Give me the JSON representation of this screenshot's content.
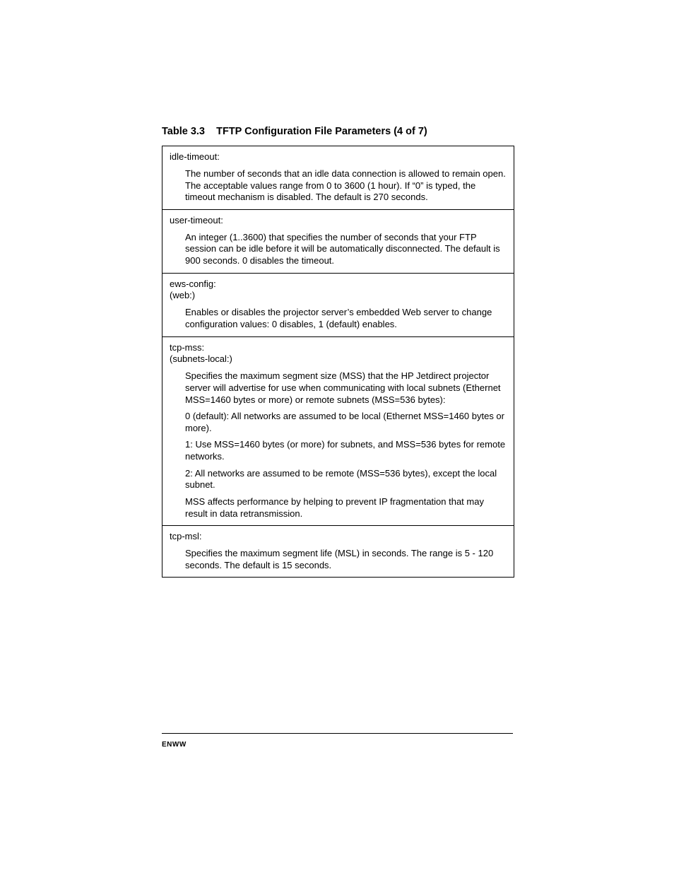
{
  "table": {
    "caption_prefix": "Table 3.3",
    "caption_title": "TFTP Configuration File Parameters (4 of 7)",
    "rows": [
      {
        "name": "idle-timeout:",
        "sub": "",
        "paras": [
          "The number of seconds that an idle data connection is allowed to remain open. The acceptable values range from 0 to 3600 (1 hour). If “0” is typed, the timeout mechanism is disabled. The default is 270 seconds."
        ]
      },
      {
        "name": "user-timeout:",
        "sub": "",
        "paras": [
          "An integer (1..3600) that specifies the number of seconds that your FTP session can be idle before it will be automatically disconnected. The default is 900 seconds. 0 disables the timeout."
        ]
      },
      {
        "name": "ews-config:",
        "sub": "(web:)",
        "paras": [
          "Enables or disables the projector server’s embedded Web server to change configuration values: 0 disables, 1 (default) enables."
        ]
      },
      {
        "name": "tcp-mss:",
        "sub": "(subnets-local:)",
        "paras": [
          "Specifies the maximum segment size (MSS) that the HP Jetdirect projector server will advertise for use when communicating with local subnets (Ethernet MSS=1460 bytes or more) or remote subnets (MSS=536 bytes):",
          "0 (default): All networks are assumed to be local (Ethernet MSS=1460 bytes or more).",
          "1: Use MSS=1460 bytes (or more) for subnets, and MSS=536 bytes for remote networks.",
          "2: All networks are assumed to be remote (MSS=536 bytes), except the local subnet.",
          "MSS affects performance by helping to prevent IP fragmentation that may result in data retransmission."
        ]
      },
      {
        "name": "tcp-msl:",
        "sub": "",
        "paras": [
          "Specifies the maximum segment life (MSL) in seconds. The range is 5 - 120 seconds. The default is 15 seconds."
        ]
      }
    ]
  },
  "footer": {
    "left": "ENWW"
  }
}
